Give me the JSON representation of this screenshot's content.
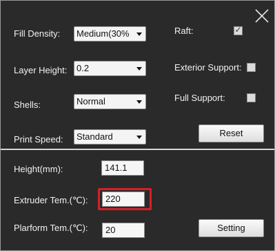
{
  "settings": {
    "fill_density": {
      "label": "Fill Density:",
      "value": "Medium(30%"
    },
    "layer_height": {
      "label": "Layer Height:",
      "value": "0.2"
    },
    "shells": {
      "label": "Shells:",
      "value": "Normal"
    },
    "print_speed": {
      "label": "Print Speed:",
      "value": "Standard"
    },
    "raft": {
      "label": "Raft:",
      "checked": true
    },
    "exterior_support": {
      "label": "Exterior Support:",
      "checked": false
    },
    "full_support": {
      "label": "Full Support:",
      "checked": false
    },
    "reset_button": "Reset"
  },
  "temperature": {
    "height": {
      "label": "Height(mm):",
      "value": "141.1"
    },
    "extruder_temp": {
      "label": "Extruder Tem.(℃):",
      "value": "220"
    },
    "platform_temp": {
      "label": "Plarform Tem.(℃):",
      "value": "20"
    },
    "setting_button": "Setting"
  },
  "icons": {
    "close": "close-icon",
    "check": "checkmark-icon",
    "dropdown": "chevron-down-icon"
  },
  "colors": {
    "background": "#2a2a2a",
    "highlight": "#d81f26",
    "divider": "#d8d8d8"
  }
}
